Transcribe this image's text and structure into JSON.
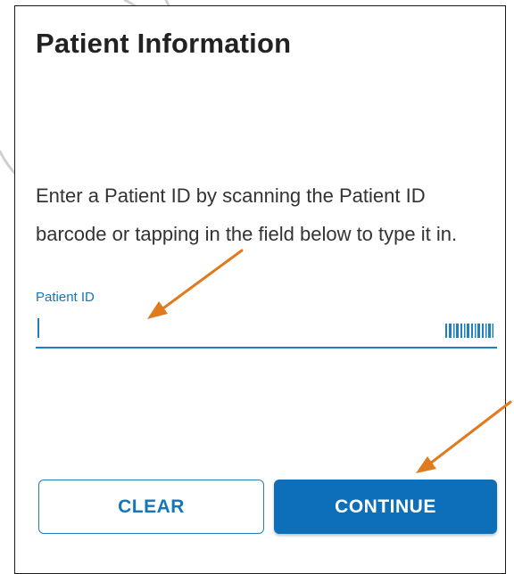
{
  "panel": {
    "title": "Patient Information",
    "instructions": "Enter a Patient ID by scanning the Patient ID barcode or tapping in the field below to type it in."
  },
  "patient_id_field": {
    "label": "Patient ID",
    "value": "",
    "icon": "barcode-icon"
  },
  "buttons": {
    "clear_label": "CLEAR",
    "continue_label": "CONTINUE"
  },
  "annotations": {
    "arrow_color": "#e07a1f",
    "arrow_targets": [
      "patient-id-field",
      "continue-button"
    ]
  },
  "colors": {
    "accent": "#1f7fc3",
    "primary_button": "#0d6fba"
  }
}
